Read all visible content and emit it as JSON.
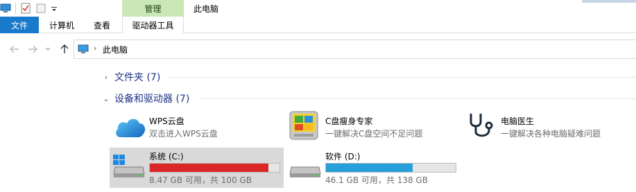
{
  "window": {
    "title": "此电脑",
    "manage_tab": "管理"
  },
  "ribbon": {
    "tabs": [
      {
        "label": "文件"
      },
      {
        "label": "计算机"
      },
      {
        "label": "查看"
      },
      {
        "label": "驱动器工具"
      }
    ]
  },
  "address": {
    "separator": "›",
    "path": "此电脑"
  },
  "groups": {
    "folders": {
      "chevron": "›",
      "label": "文件夹 (7)"
    },
    "devices": {
      "chevron": "⌄",
      "label": "设备和驱动器 (7)"
    }
  },
  "apps": [
    {
      "title": "WPS云盘",
      "subtitle": "双击进入WPS云盘",
      "icon": "cloud-icon"
    },
    {
      "title": "C盘瘦身专家",
      "subtitle": "一键解决C盘空间不足问题",
      "icon": "windows-tile-icon"
    },
    {
      "title": "电脑医生",
      "subtitle": "一键解决各种电脑疑难问题",
      "icon": "stethoscope-icon"
    }
  ],
  "drives": [
    {
      "title": "系统 (C:)",
      "usage": "8.47 GB 可用，共 100 GB",
      "used_fraction": 0.915,
      "bar_color": "#da2626"
    },
    {
      "title": "软件 (D:)",
      "usage": "46.1 GB 可用，共 138 GB",
      "used_fraction": 0.666,
      "bar_color": "#26a0da"
    }
  ]
}
